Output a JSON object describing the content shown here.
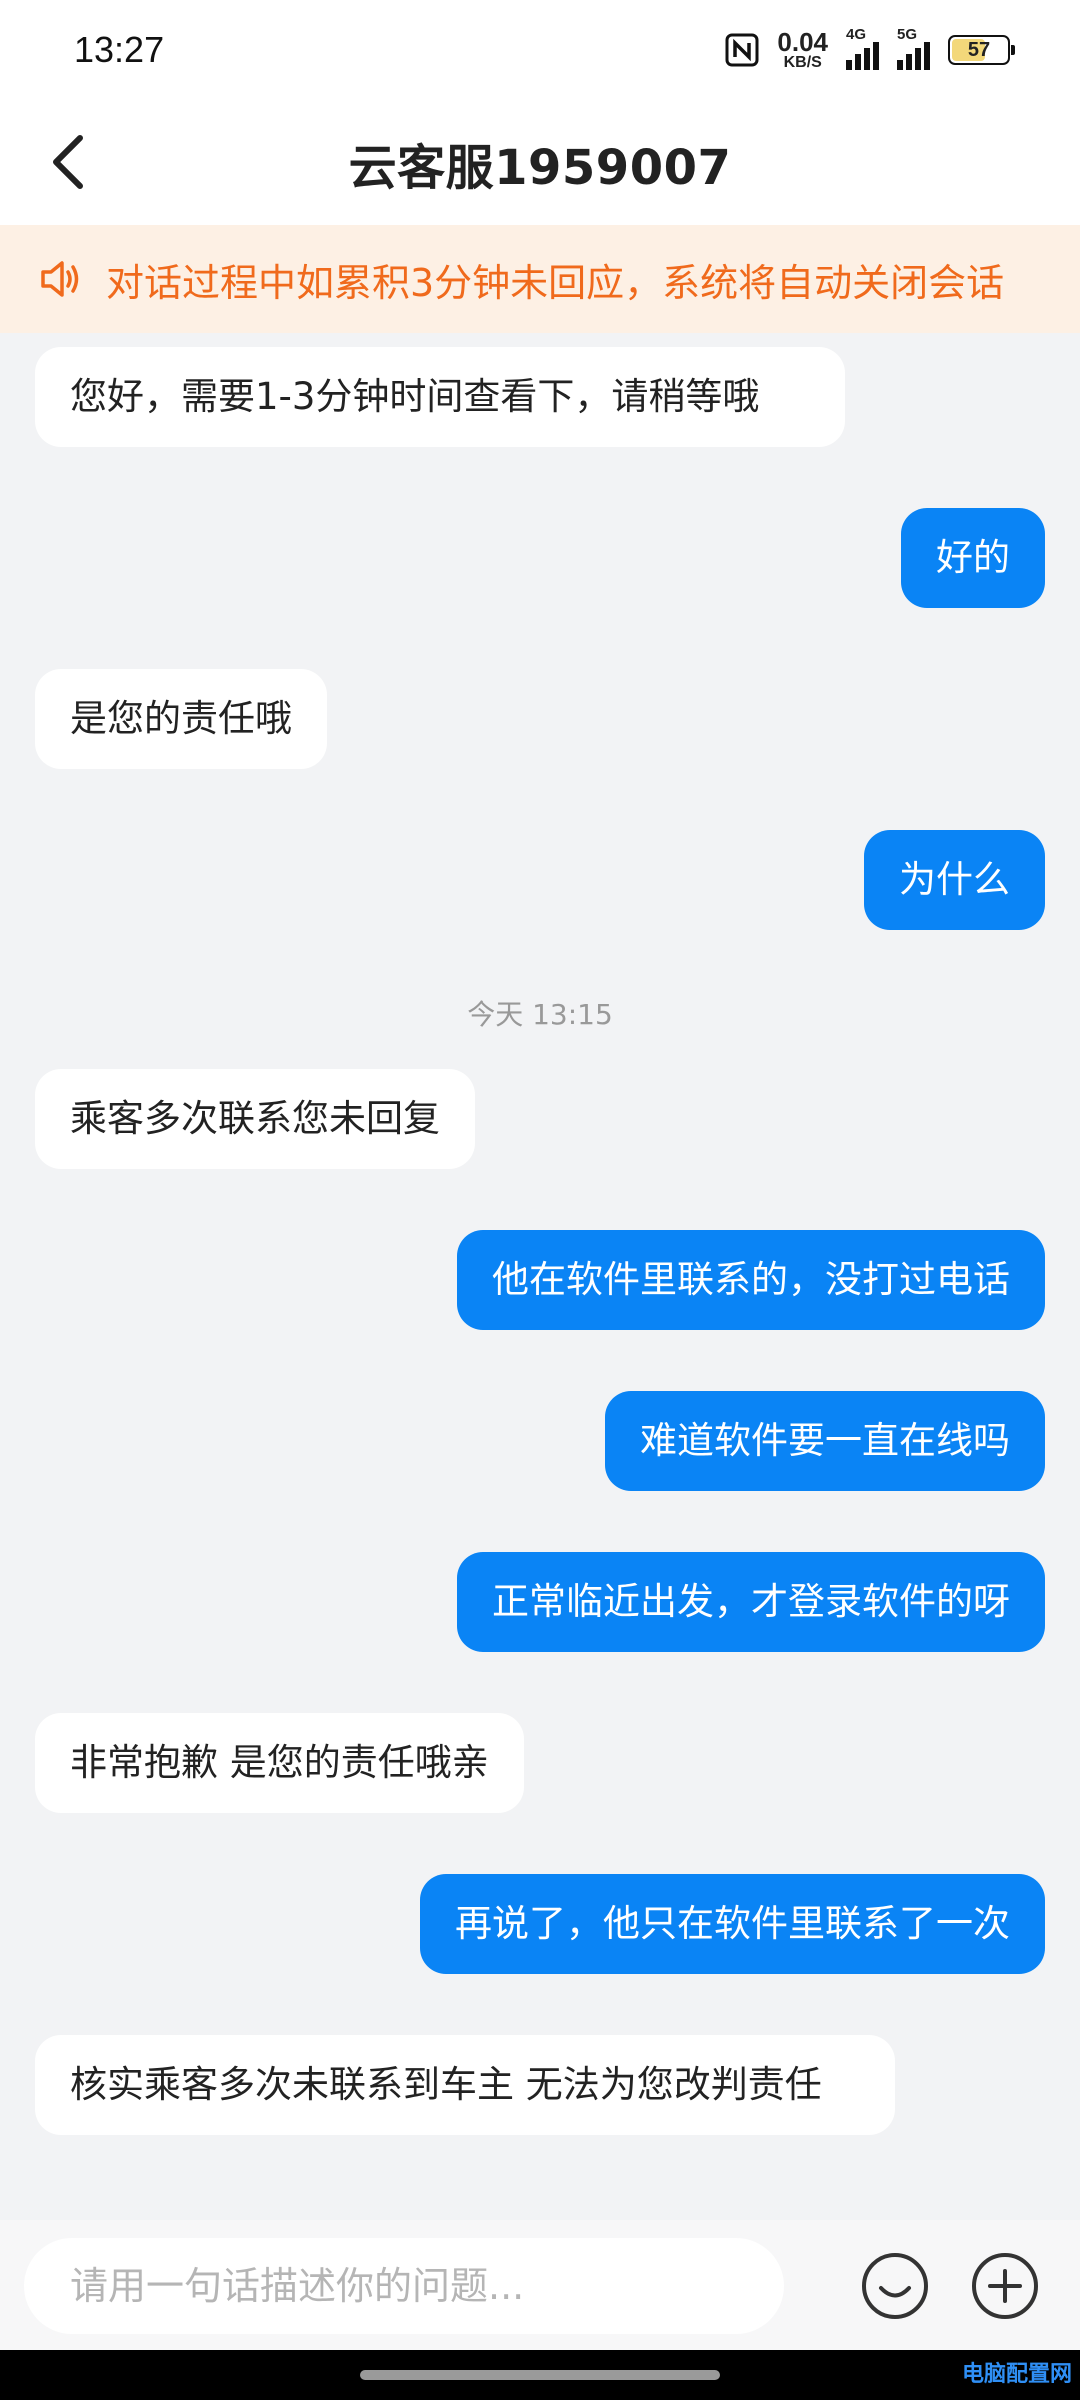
{
  "status_bar": {
    "time": "13:27",
    "net_speed_value": "0.04",
    "net_speed_unit": "KB/S",
    "signal1_tag": "4G",
    "signal2_tag": "5G",
    "battery_level": "57"
  },
  "header": {
    "title": "云客服1959007"
  },
  "notice": {
    "text": "对话过程中如累积3分钟未回应，系统将自动关闭会话"
  },
  "messages": [
    {
      "side": "in",
      "text": "您好，需要1-3分钟时间查看下，请稍等哦"
    },
    {
      "side": "out",
      "text": "好的"
    },
    {
      "side": "in",
      "text": "是您的责任哦"
    },
    {
      "side": "out",
      "text": "为什么"
    },
    {
      "side": "in",
      "text": "乘客多次联系您未回复"
    },
    {
      "side": "out",
      "text": "他在软件里联系的，没打过电话"
    },
    {
      "side": "out",
      "text": "难道软件要一直在线吗"
    },
    {
      "side": "out",
      "text": "正常临近出发，才登录软件的呀"
    },
    {
      "side": "in",
      "text": "非常抱歉 是您的责任哦亲"
    },
    {
      "side": "out",
      "text": "再说了，他只在软件里联系了一次"
    },
    {
      "side": "in",
      "text": "核实乘客多次未联系到车主  无法为您改判责任"
    }
  ],
  "timestamp": "今天 13:15",
  "input": {
    "placeholder": "请用一句话描述你的问题..."
  },
  "watermark": "电脑配置网",
  "colors": {
    "accent": "#0a84f5",
    "notice_text": "#f06a1c",
    "notice_bg": "#fdf0e4"
  },
  "icons": [
    "back-arrow-icon",
    "speaker-icon",
    "emoji-icon",
    "plus-icon"
  ]
}
